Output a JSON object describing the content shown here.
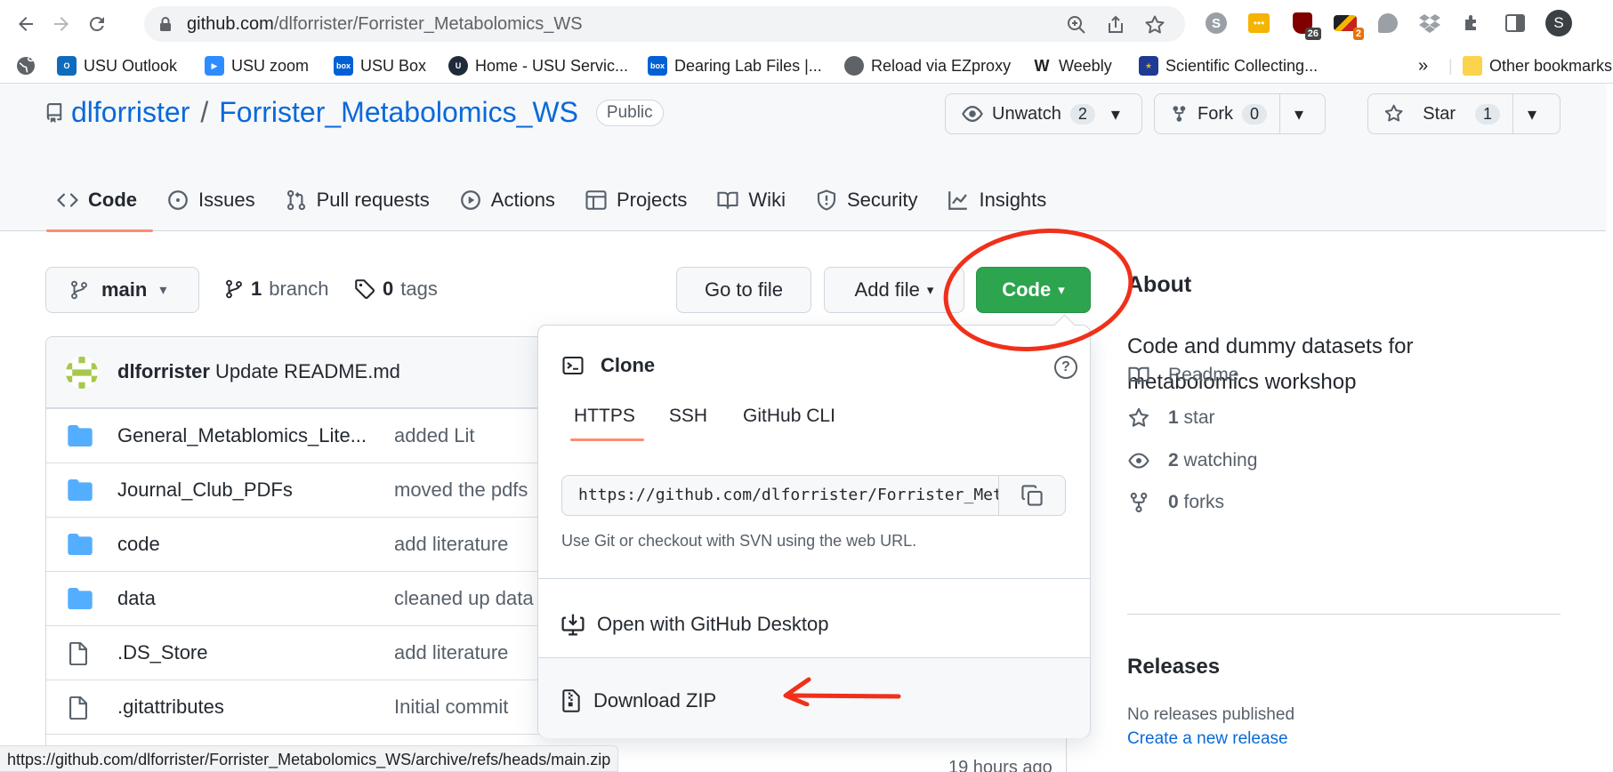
{
  "browser": {
    "url_host": "github.com",
    "url_path": "/dlforrister/Forrister_Metabolomics_WS",
    "bookmarks": [
      {
        "label": "USU Outlook",
        "color": "#0f6cbd"
      },
      {
        "label": "USU zoom",
        "color": "#2d8cff"
      },
      {
        "label": "USU Box",
        "color": "#0061d5"
      },
      {
        "label": "Home - USU Servic...",
        "color": "#1f2b3a"
      },
      {
        "label": "Dearing Lab Files |...",
        "color": "#0061d5"
      },
      {
        "label": "Reload via EZproxy",
        "color": "#5f6368"
      },
      {
        "label": "Weebly",
        "color": "#202124"
      },
      {
        "label": "Scientific Collecting...",
        "color": "#d29b00"
      }
    ],
    "other_bookmarks": "Other bookmarks",
    "more_bookmarks": "»",
    "extension_badges": {
      "ext1": "26",
      "ext2": "2"
    },
    "profile_initial": "S",
    "status_url": "https://github.com/dlforrister/Forrister_Metabolomics_WS/archive/refs/heads/main.zip"
  },
  "repo": {
    "owner": "dlforrister",
    "separator": "/",
    "name": "Forrister_Metabolomics_WS",
    "visibility": "Public",
    "unwatch_label": "Unwatch",
    "watch_count": "2",
    "fork_label": "Fork",
    "fork_count": "0",
    "star_label": "Star",
    "star_count": "1"
  },
  "tabs": [
    {
      "label": "Code",
      "icon": "code-icon",
      "active": true
    },
    {
      "label": "Issues",
      "icon": "issue-icon"
    },
    {
      "label": "Pull requests",
      "icon": "pull-request-icon"
    },
    {
      "label": "Actions",
      "icon": "play-icon"
    },
    {
      "label": "Projects",
      "icon": "table-icon"
    },
    {
      "label": "Wiki",
      "icon": "book-icon"
    },
    {
      "label": "Security",
      "icon": "shield-icon"
    },
    {
      "label": "Insights",
      "icon": "graph-icon"
    }
  ],
  "branch": {
    "current": "main",
    "branch_count": "1",
    "branch_label": "branch",
    "tag_count": "0",
    "tag_label": "tags",
    "go_to_file": "Go to file",
    "add_file": "Add file",
    "code_button": "Code"
  },
  "commit": {
    "author": "dlforrister",
    "message": "Update README.md"
  },
  "files": [
    {
      "name": "General_Metablomics_Lite...",
      "message": "added Lit",
      "type": "folder"
    },
    {
      "name": "Journal_Club_PDFs",
      "message": "moved the pdfs",
      "type": "folder"
    },
    {
      "name": "code",
      "message": "add literature",
      "type": "folder"
    },
    {
      "name": "data",
      "message": "cleaned up data",
      "type": "folder"
    },
    {
      "name": ".DS_Store",
      "message": "add literature",
      "type": "file"
    },
    {
      "name": ".gitattributes",
      "message": "Initial commit",
      "type": "file"
    }
  ],
  "last_row_time": "19 hours ago",
  "about": {
    "heading": "About",
    "description": "Code and dummy datasets for metabolomics workshop",
    "readme": "Readme",
    "stars_count": "1",
    "stars_label": "star",
    "watching_count": "2",
    "watching_label": "watching",
    "forks_count": "0",
    "forks_label": "forks"
  },
  "releases": {
    "heading": "Releases",
    "none": "No releases published",
    "create_link": "Create a new release"
  },
  "clone_popup": {
    "title": "Clone",
    "help": "?",
    "tabs": [
      "HTTPS",
      "SSH",
      "GitHub CLI"
    ],
    "active_tab": "HTTPS",
    "url": "https://github.com/dlforrister/Forrister_Metabolomics_WS.git",
    "hint": "Use Git or checkout with SVN using the web URL.",
    "open_desktop": "Open with GitHub Desktop",
    "download_zip": "Download ZIP"
  },
  "colors": {
    "link": "#0969da",
    "green_button": "#2da44e",
    "tab_underline": "#fd8c73",
    "annotation_red": "#f0301a",
    "folder": "#54aeff"
  }
}
